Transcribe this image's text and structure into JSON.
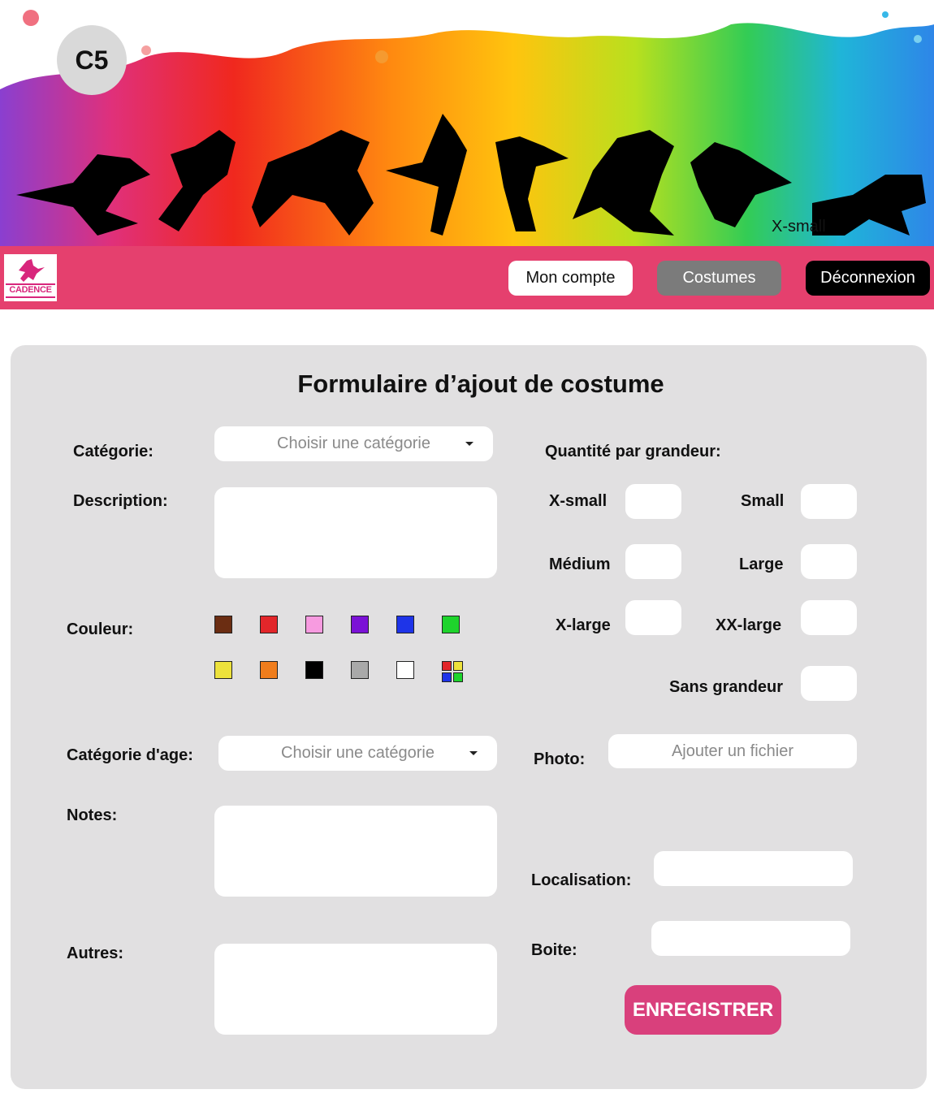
{
  "banner": {
    "badge_text": "C5",
    "stray_text": "X-small"
  },
  "nav": {
    "logo_text": "CADENCE",
    "account_label": "Mon compte",
    "costumes_label": "Costumes",
    "logout_label": "Déconnexion"
  },
  "form": {
    "title": "Formulaire d’ajout de costume",
    "category_label": "Catégorie:",
    "category_placeholder": "Choisir une catégorie",
    "description_label": "Description:",
    "color_label": "Couleur:",
    "colors": [
      "#6b2d12",
      "#e2262a",
      "#f79be0",
      "#7b12d6",
      "#1e34e8",
      "#1ed42c",
      "#ede23c",
      "#f07d1c",
      "#000000",
      "#a9a9a9",
      "#ffffff",
      "multi"
    ],
    "multi_colors": [
      "#e2262a",
      "#ede23c",
      "#1e34e8",
      "#1ed42c"
    ],
    "age_category_label": "Catégorie d'age:",
    "age_category_placeholder": "Choisir une catégorie",
    "notes_label": "Notes:",
    "others_label": "Autres:",
    "qty_label": "Quantité par grandeur:",
    "sizes": {
      "xsmall": "X-small",
      "small": "Small",
      "medium": "Médium",
      "large": "Large",
      "xlarge": "X-large",
      "xxlarge": "XX-large",
      "none": "Sans grandeur"
    },
    "photo_label": "Photo:",
    "photo_button": "Ajouter un fichier",
    "location_label": "Localisation:",
    "box_label": "Boite:",
    "save_label": "ENREGISTRER"
  }
}
